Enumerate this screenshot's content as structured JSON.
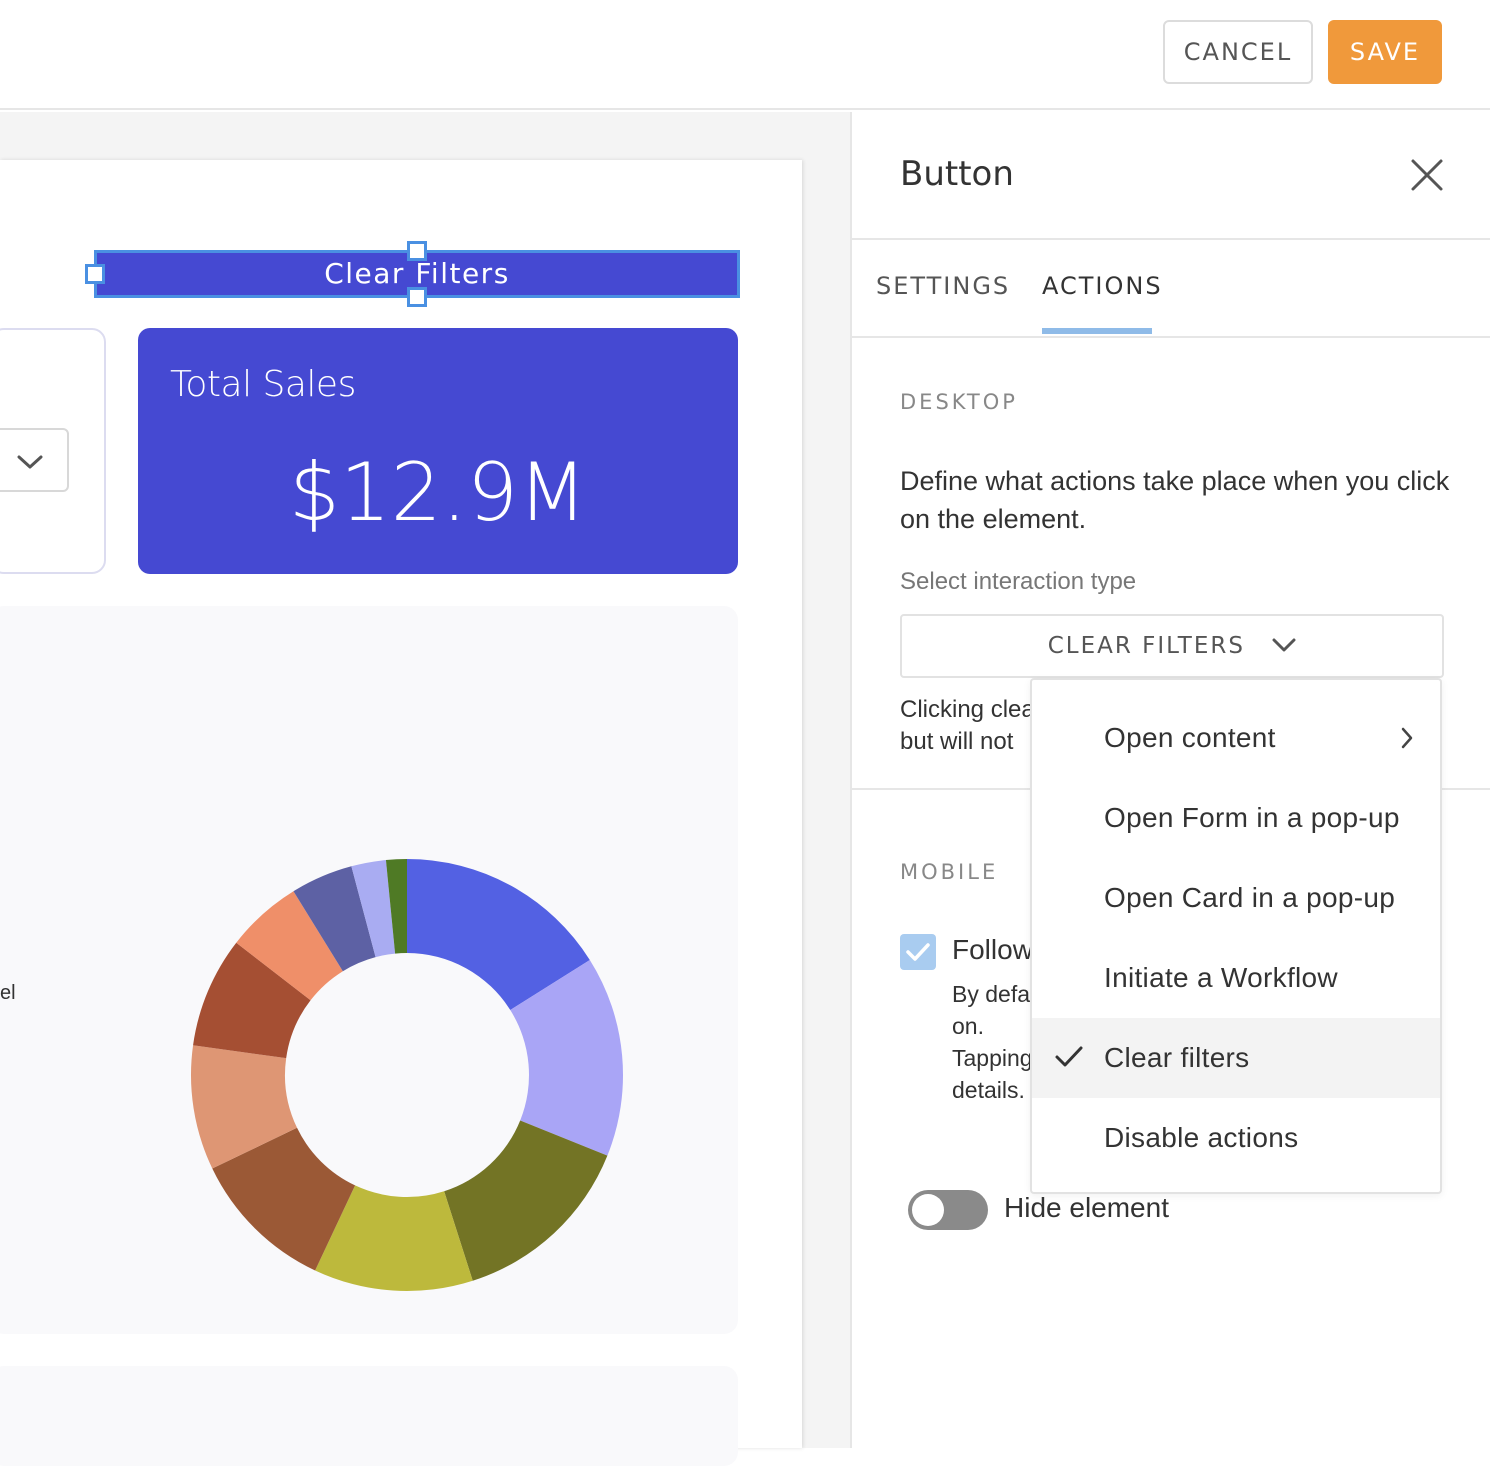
{
  "toolbar": {
    "cancel_label": "CANCEL",
    "save_label": "SAVE"
  },
  "canvas": {
    "button_label": "Clear Filters",
    "kpi": {
      "title": "Total Sales",
      "value": "$12.9M"
    },
    "cut_label": "el",
    "accent_color": "#4549d2"
  },
  "chart_data": {
    "type": "pie",
    "variant": "donut",
    "values": [
      15.5,
      14.5,
      13.5,
      11.5,
      10.5,
      9.0,
      8.0,
      5.5,
      4.5,
      2.5,
      1.5
    ],
    "colors": [
      "#5361e3",
      "#a9a5f6",
      "#737425",
      "#bdb93c",
      "#9b5936",
      "#de9674",
      "#a54f33",
      "#ef8f69",
      "#5d61a4",
      "#a9acf2",
      "#4f7a25"
    ]
  },
  "panel": {
    "title": "Button",
    "tabs": [
      {
        "label": "SETTINGS"
      },
      {
        "label": "ACTIONS"
      }
    ],
    "desktop": {
      "section_label": "DESKTOP",
      "description": "Define what actions take place when you click on the element.",
      "interaction_label": "Select interaction type",
      "selected_value": "CLEAR FILTERS",
      "hint_line1": "Clicking clea",
      "hint_line2": "but will not"
    },
    "mobile": {
      "section_label": "MOBILE",
      "follow_label": "Follow",
      "follow_desc_line1": "By defa",
      "follow_desc_line2": "on.",
      "follow_desc_line3": "Tapping",
      "follow_desc_line4": "details."
    },
    "hide_element_label": "Hide element"
  },
  "dropdown": {
    "options": [
      {
        "label": "Open content"
      },
      {
        "label": "Open Form in a pop-up"
      },
      {
        "label": "Open Card in a pop-up"
      },
      {
        "label": "Initiate a Workflow"
      },
      {
        "label": "Clear filters"
      },
      {
        "label": "Disable actions"
      }
    ]
  }
}
